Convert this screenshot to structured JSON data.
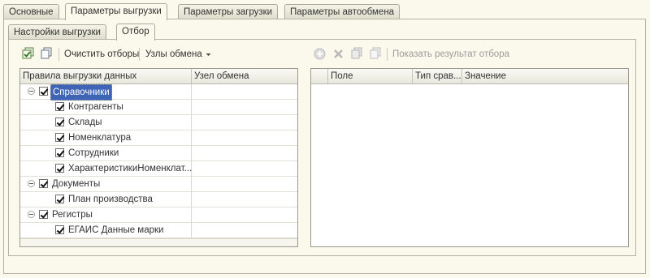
{
  "tabs": [
    {
      "label": "Основные"
    },
    {
      "label": "Параметры выгрузки"
    },
    {
      "label": "Параметры загрузки"
    },
    {
      "label": "Параметры автообмена"
    }
  ],
  "subtabs": [
    {
      "label": "Настройки выгрузки"
    },
    {
      "label": "Отбор"
    }
  ],
  "left_toolbar": {
    "clear_filters": "Очистить отборы",
    "exchange_nodes": "Узлы обмена"
  },
  "right_toolbar": {
    "show_result": "Показать результат отбора"
  },
  "rules_grid": {
    "columns": [
      "Правила выгрузки данных",
      "Узел обмена"
    ],
    "rows": [
      {
        "label": "Справочники",
        "level": 0,
        "checked": true,
        "expandable": true,
        "selected": true
      },
      {
        "label": "Контрагенты",
        "level": 1,
        "checked": true
      },
      {
        "label": "Склады",
        "level": 1,
        "checked": true
      },
      {
        "label": "Номенклатура",
        "level": 1,
        "checked": true
      },
      {
        "label": "Сотрудники",
        "level": 1,
        "checked": true
      },
      {
        "label": "ХарактеристикиНоменклат...",
        "level": 1,
        "checked": true
      },
      {
        "label": "Документы",
        "level": 0,
        "checked": true,
        "expandable": true
      },
      {
        "label": "План производства",
        "level": 1,
        "checked": true
      },
      {
        "label": "Регистры",
        "level": 0,
        "checked": true,
        "expandable": true
      },
      {
        "label": "ЕГАИС Данные марки",
        "level": 1,
        "checked": true
      }
    ]
  },
  "filter_grid": {
    "columns": [
      "Поле",
      "Тип срав...",
      "Значение"
    ]
  }
}
